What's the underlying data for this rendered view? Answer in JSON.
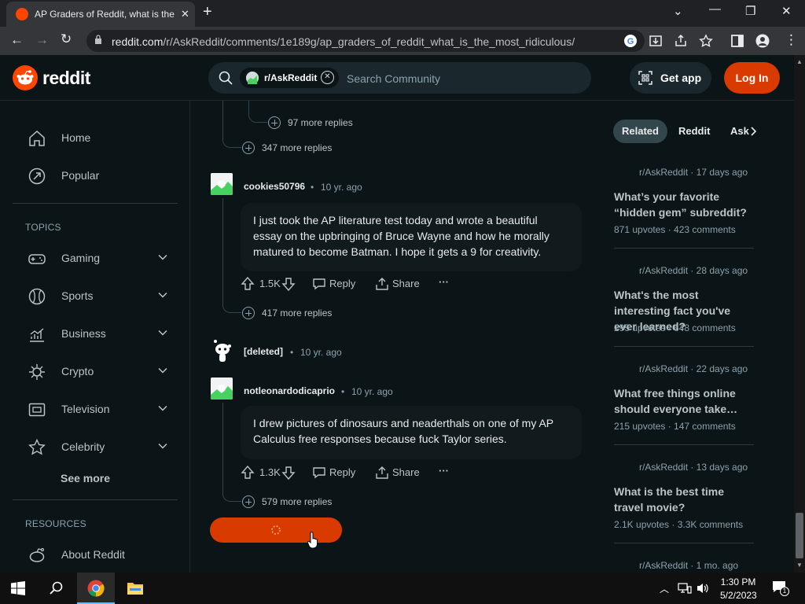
{
  "browser": {
    "tab_title": "AP Graders of Reddit, what is the",
    "url_domain": "reddit.com",
    "url_path": "/r/AskReddit/comments/1e189g/ap_graders_of_reddit_what_is_the_most_ridiculous/"
  },
  "header": {
    "logo_text": "reddit",
    "chip_label": "r/AskReddit",
    "search_placeholder": "Search Community",
    "get_app": "Get app",
    "login": "Log In"
  },
  "sidebar": {
    "items": [
      {
        "label": "Home",
        "icon": "home-icon"
      },
      {
        "label": "Popular",
        "icon": "popular-icon"
      }
    ],
    "topics_heading": "TOPICS",
    "topics": [
      {
        "label": "Gaming",
        "icon": "gamepad-icon"
      },
      {
        "label": "Sports",
        "icon": "ball-icon"
      },
      {
        "label": "Business",
        "icon": "chart-icon"
      },
      {
        "label": "Crypto",
        "icon": "crypto-icon"
      },
      {
        "label": "Television",
        "icon": "tv-icon"
      },
      {
        "label": "Celebrity",
        "icon": "star-icon"
      }
    ],
    "see_more": "See more",
    "resources_heading": "RESOURCES",
    "resources": [
      {
        "label": "About Reddit",
        "icon": "alien-icon"
      }
    ]
  },
  "comments": {
    "more_97": "97 more replies",
    "more_347": "347 more replies",
    "c1": {
      "author": "cookies50796",
      "time": "10 yr. ago",
      "body": "I just took the AP literature test today and wrote a beautiful essay on the upbringing of Bruce Wayne and how he morally matured to become Batman. I hope it gets a 9 for creativity.",
      "votes": "1.5K",
      "reply": "Reply",
      "share": "Share",
      "more": "417 more replies"
    },
    "deleted": {
      "author": "[deleted]",
      "time": "10 yr. ago"
    },
    "c2": {
      "author": "notleonardodicaprio",
      "time": "10 yr. ago",
      "body": "I drew pictures of dinosaurs and neaderthals on one of my AP Calculus free responses because fuck Taylor series.",
      "votes": "1.3K",
      "reply": "Reply",
      "share": "Share",
      "more": "579 more replies"
    },
    "dot": "•",
    "ellipsis": "···"
  },
  "right": {
    "tabs": [
      "Related",
      "Reddit",
      "Ask"
    ],
    "cards": [
      {
        "meta": "r/AskReddit · 17 days ago",
        "question": "What’s your favorite “hidden gem” subreddit?",
        "stats": "871 upvotes · 423 comments"
      },
      {
        "meta": "r/AskReddit · 28 days ago",
        "question": "What's the most interesting fact you've ever learned?",
        "stats": "295 upvotes · 648 comments"
      },
      {
        "meta": "r/AskReddit · 22 days ago",
        "question": "What free things online should everyone take…",
        "stats": "215 upvotes · 147 comments"
      },
      {
        "meta": "r/AskReddit · 13 days ago",
        "question": "What is the best time travel movie?",
        "stats": "2.1K upvotes · 3.3K comments"
      },
      {
        "meta": "r/AskReddit · 1 mo. ago",
        "question": "",
        "stats": ""
      }
    ]
  },
  "taskbar": {
    "time": "1:30 PM",
    "date": "5/2/2023",
    "notification_count": "1"
  },
  "colors": {
    "accent": "#d93a00",
    "reddit_orange": "#ff4500",
    "background": "#0b1416"
  }
}
